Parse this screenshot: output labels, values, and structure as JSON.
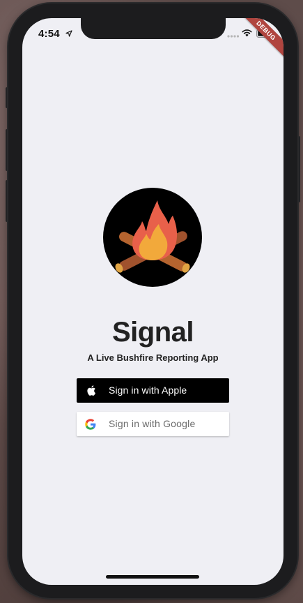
{
  "status_bar": {
    "time": "4:54",
    "location_icon": "location-arrow-icon",
    "cellular_icon": "cellular-signal-icon",
    "wifi_icon": "wifi-icon",
    "battery_icon": "battery-icon"
  },
  "debug_banner": {
    "label": "DEBUG",
    "color": "#b0453f"
  },
  "logo": {
    "icon": "campfire-icon",
    "colors": {
      "background": "#000000",
      "flame_outer": "#e8604a",
      "flame_inner": "#f2a93b",
      "logs": "#a0522d"
    }
  },
  "app": {
    "title": "Signal",
    "subtitle": "A Live Bushfire Reporting App"
  },
  "buttons": {
    "apple": {
      "label": "Sign in with Apple",
      "icon": "apple-logo-icon",
      "background": "#000000",
      "text_color": "#ffffff"
    },
    "google": {
      "label": "Sign in with Google",
      "icon": "google-logo-icon",
      "background": "#ffffff",
      "text_color": "#6b6b6b"
    }
  }
}
